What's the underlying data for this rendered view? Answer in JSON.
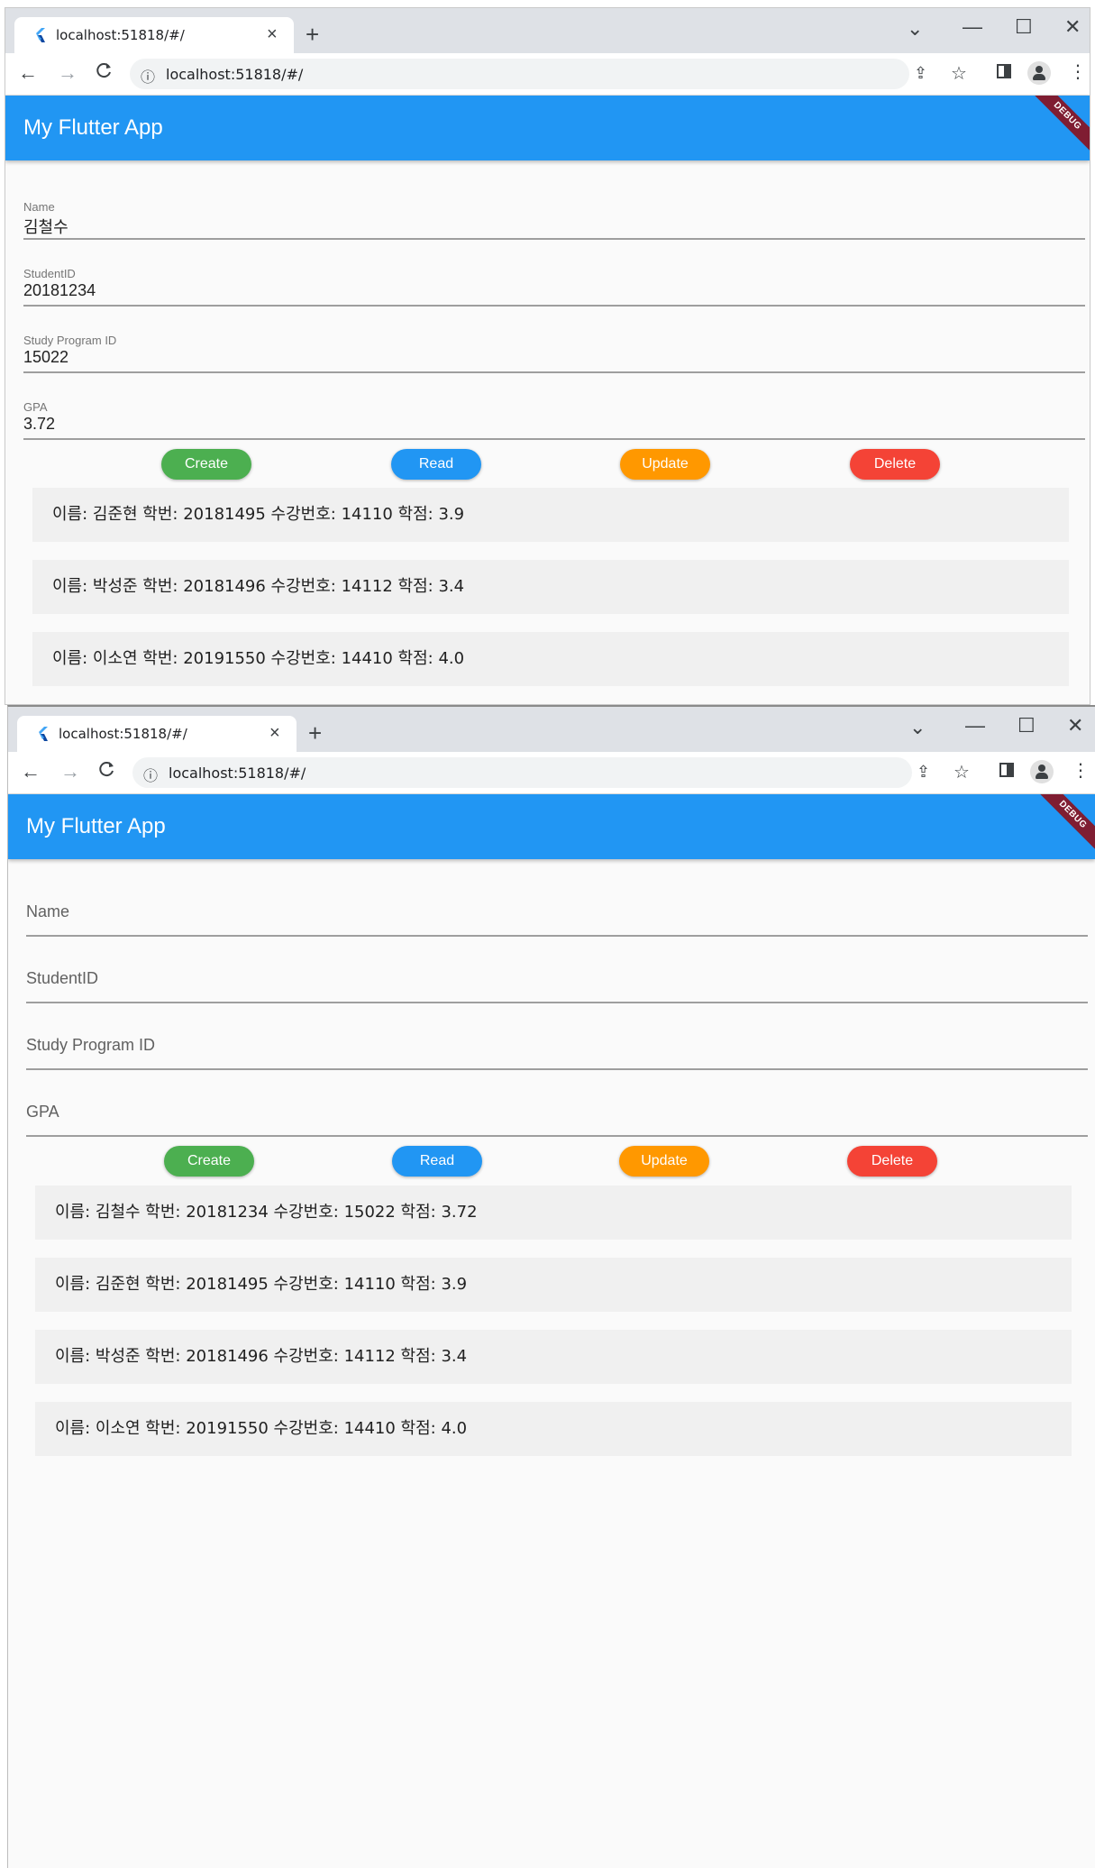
{
  "browser": {
    "tab_title": "localhost:51818/#/",
    "tab_close": "×",
    "new_tab": "+",
    "url": "localhost:51818/#/",
    "window_controls": {
      "chevron": "⌄",
      "minimize": "—",
      "maximize": "☐",
      "close": "✕"
    },
    "nav": {
      "back": "←",
      "forward": "→",
      "reload": "C"
    },
    "icons": {
      "favicon": "flutter-logo",
      "info": "info-icon",
      "share": "share-icon",
      "star": "star-icon",
      "side_panel": "side-panel-icon",
      "profile": "profile-icon",
      "menu": "kebab-menu-icon"
    }
  },
  "app": {
    "title": "My Flutter App",
    "debug_banner": "DEBUG",
    "accent": "#2196f3"
  },
  "form_labels": {
    "name": "Name",
    "student_id": "StudentID",
    "program_id": "Study Program ID",
    "gpa": "GPA"
  },
  "screen1": {
    "form": {
      "name": "김철수",
      "student_id": "20181234",
      "program_id": "15022",
      "gpa": "3.72"
    },
    "list": [
      "이름: 김준현 학번: 20181495 수강번호: 14110 학점: 3.9",
      "이름: 박성준 학번: 20181496 수강번호: 14112 학점: 3.4",
      "이름: 이소연 학번: 20191550 수강번호: 14410 학점: 4.0"
    ]
  },
  "screen2": {
    "list": [
      "이름: 김철수 학번: 20181234 수강번호: 15022 학점: 3.72",
      "이름: 김준현 학번: 20181495 수강번호: 14110 학점: 3.9",
      "이름: 박성준 학번: 20181496 수강번호: 14112 학점: 3.4",
      "이름: 이소연 학번: 20191550 수강번호: 14410 학점: 4.0"
    ]
  },
  "buttons": {
    "create": {
      "label": "Create",
      "color": "#4caf50"
    },
    "read": {
      "label": "Read",
      "color": "#2196f3"
    },
    "update": {
      "label": "Update",
      "color": "#ff9800"
    },
    "delete": {
      "label": "Delete",
      "color": "#f44336"
    }
  }
}
